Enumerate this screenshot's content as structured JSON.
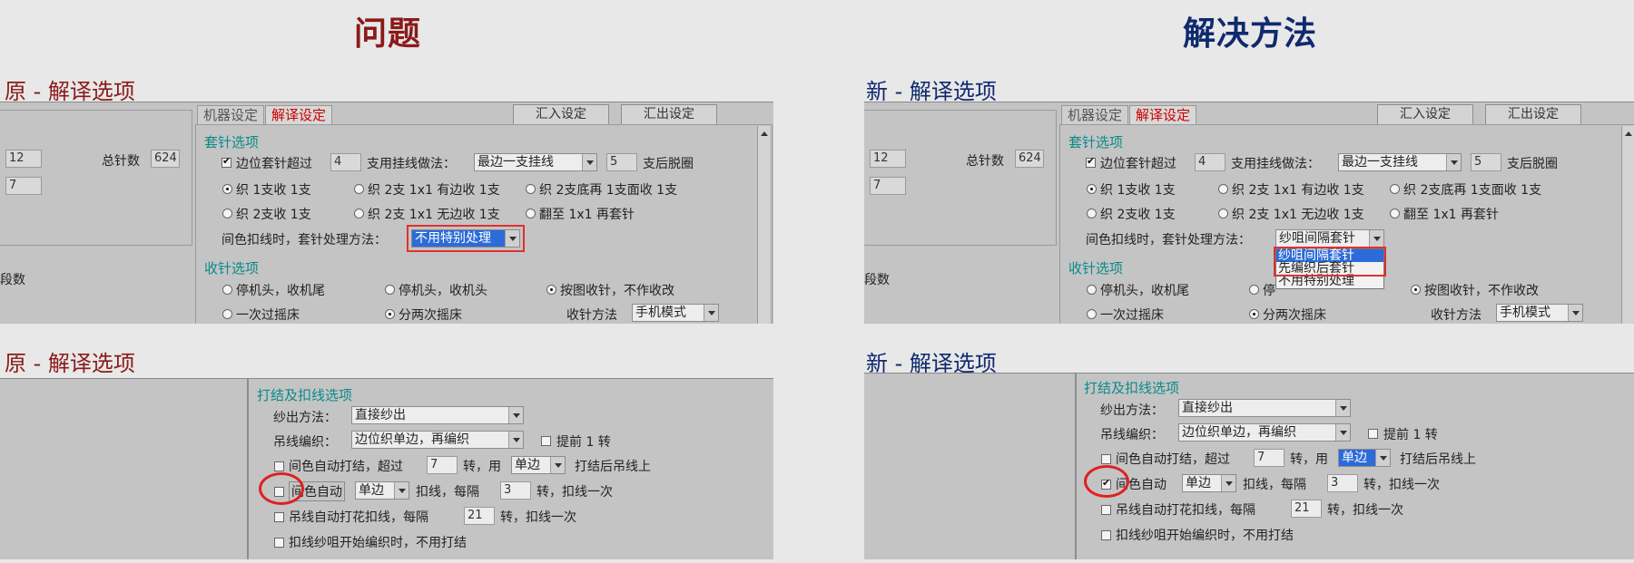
{
  "titles": {
    "problem": "问题",
    "solution": "解决方法"
  },
  "sections": {
    "orig_1": "原 - 解译选项",
    "new_1": "新 - 解译选项",
    "orig_2": "原 - 解译选项",
    "new_2": "新 - 解译选项"
  },
  "tabs": {
    "machine": "机器设定",
    "decode": "解译设定"
  },
  "buttons": {
    "import": "汇入设定",
    "export": "汇出设定"
  },
  "left_group": {
    "field1": "12",
    "field2": "7",
    "total_label": "总针数",
    "total_value": "624",
    "segments_label": "段数"
  },
  "cover_options": {
    "group_title": "套针选项",
    "edge_over_label": "边位套针超过",
    "edge_over_value": "4",
    "method_label": "支用挂线做法：",
    "method_value": "最边一支挂线",
    "after_value": "5",
    "after_label": "支后脱圈",
    "radio": [
      "织 1支收 1支",
      "织 2支 1x1 有边收 1支",
      "织 2支底再 1支面收 1支",
      "织 2支收 1支",
      "织 2支 1x1 无边收 1支",
      "翻至 1x1 再套针"
    ],
    "color_label": "间色扣线时，套针处理方法：",
    "color_value_orig": "不用特别处理",
    "color_value_new": "纱咀间隔套针",
    "dropdown_options": [
      "纱咀间隔套针",
      "先编织后套针",
      "不用特别处理"
    ]
  },
  "finish_options": {
    "group_title": "收针选项",
    "radio": [
      "停机头，收机尾",
      "停机头，收机头",
      "按图收针，不作收改",
      "一次过摇床",
      "分两次摇床"
    ],
    "radio_new_truncated": "停",
    "method_label": "收针方法",
    "method_value": "手机模式"
  },
  "knot_options": {
    "group_title": "打结及扣线选项",
    "yarn_out_label": "纱出方法：",
    "yarn_out_value": "直接纱出",
    "hang_label": "吊线编织：",
    "hang_value": "边位织单边，再编织",
    "advance_label": "提前 1 转",
    "auto_knot_label": "间色自动打结，超过",
    "auto_knot_value": "7",
    "turn_use": "转，用",
    "side_value": "单边",
    "after_knot": "打结后吊线上",
    "auto_label": "间色自动",
    "side2_value": "单边",
    "tuck_every": "扣线，每隔",
    "tuck_value": "3",
    "tuck_once": "转，扣线一次",
    "flower_label": "吊线自动打花扣线，每隔",
    "flower_value": "21",
    "flower_once": "转，扣线一次",
    "start_label": "扣线纱咀开始编织时，不用打结"
  }
}
